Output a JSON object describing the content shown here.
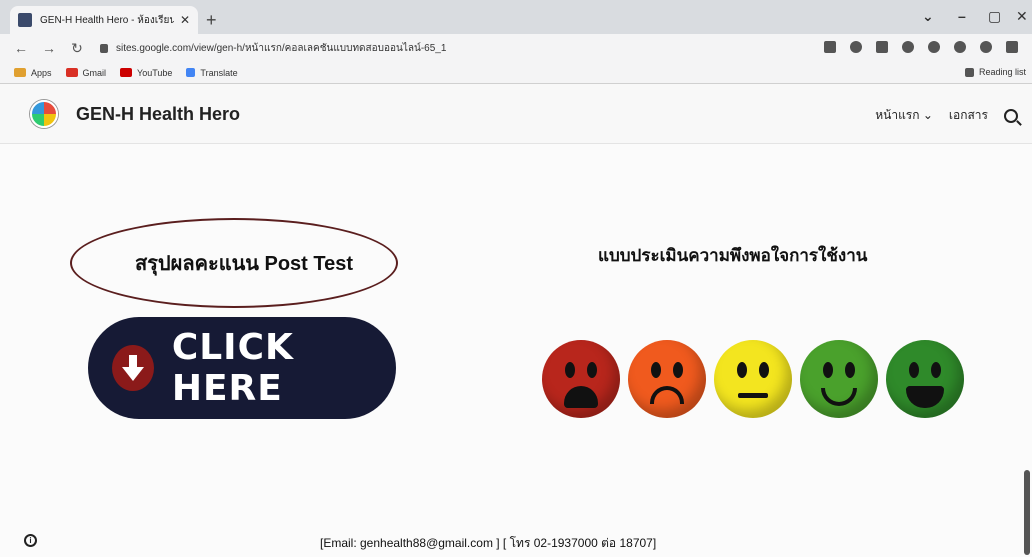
{
  "browser": {
    "tab_title": "GEN-H Health Hero - ห้องเรียนสุขภาพ",
    "url": "sites.google.com/view/gen-h/หน้าแรก/คอลเลคชันแบบทดสอบออนไลน์-65_1",
    "bookmarks": [
      "Apps",
      "Gmail",
      "YouTube",
      "Translate"
    ],
    "reading_list": "Reading list",
    "colors": {
      "gmail": "#d93025",
      "youtube": "#cc0000"
    }
  },
  "site": {
    "title": "GEN-H Health Hero",
    "nav": {
      "home": "หน้าแรก",
      "docs": "เอกสาร"
    }
  },
  "main": {
    "oval_label": "สรุปผลคะแนน  Post Test",
    "click_here": "CLICK HERE",
    "survey_title": "แบบประเมินความพึงพอใจการใช้งาน",
    "faces": [
      {
        "name": "very-dissatisfied",
        "color": "#b8261c"
      },
      {
        "name": "dissatisfied",
        "color": "#f05a1e"
      },
      {
        "name": "neutral",
        "color": "#f3e51f"
      },
      {
        "name": "satisfied",
        "color": "#4aa12c"
      },
      {
        "name": "very-satisfied",
        "color": "#2f8a2a"
      }
    ]
  },
  "footer": {
    "contact": "[Email:  genhealth88@gmail.com ]   [ โทร 02-1937000 ต่อ 18707]"
  }
}
